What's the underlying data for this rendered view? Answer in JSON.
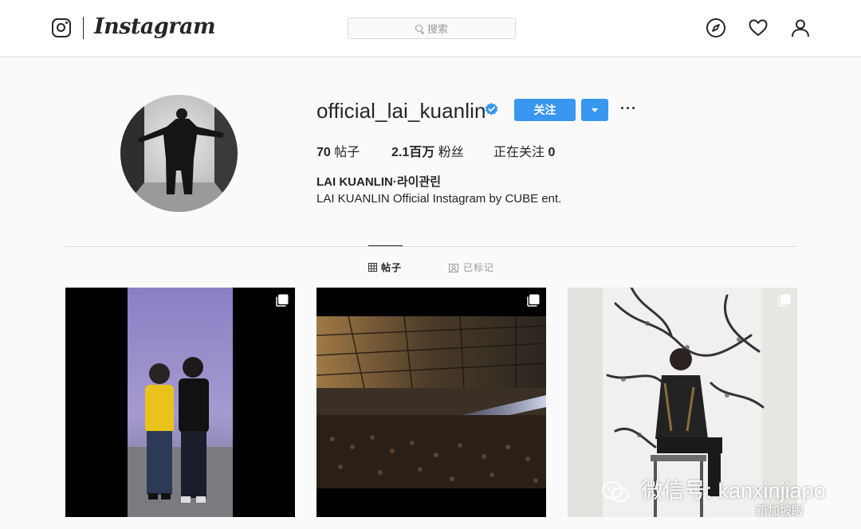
{
  "header": {
    "wordmark": "Instagram",
    "search_placeholder": "搜索",
    "icons": [
      "instagram-glyph-icon",
      "search-icon",
      "compass-icon",
      "heart-icon",
      "profile-icon"
    ]
  },
  "profile": {
    "username": "official_lai_kuanlin",
    "verified": true,
    "follow_label": "关注",
    "more_label": "···",
    "stats": {
      "posts_count": "70",
      "posts_label": "帖子",
      "followers_count": "2.1百万",
      "followers_label": "粉丝",
      "following_label": "正在关注",
      "following_count": "0"
    },
    "full_name": "LAI KUANLIN·라이관린",
    "bio": "LAI KUANLIN Official Instagram by CUBE ent."
  },
  "tabs": [
    {
      "label": "帖子",
      "icon": "grid-icon",
      "active": true
    },
    {
      "label": "已标记",
      "icon": "tagged-icon",
      "active": false
    }
  ],
  "posts": [
    {
      "type": "multi",
      "description_icon": "carousel-icon"
    },
    {
      "type": "multi",
      "description_icon": "carousel-icon"
    },
    {
      "type": "multi",
      "description_icon": "carousel-icon"
    }
  ],
  "watermark": {
    "main": "微信号: kanxinjiapo",
    "sub": "新加坡眼"
  },
  "colors": {
    "accent": "#3897f0",
    "border": "#dbdbdb",
    "background": "#fafafa",
    "text": "#262626",
    "muted": "#999999"
  }
}
